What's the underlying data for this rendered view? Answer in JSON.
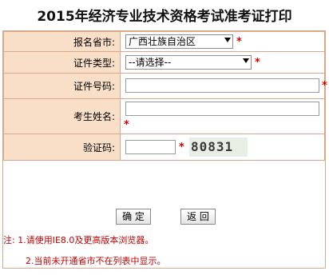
{
  "title": "2015年经济专业技术资格考试准考证打印",
  "form": {
    "province": {
      "label": "报名省市:",
      "value": "广西壮族自治区",
      "required": "*"
    },
    "id_type": {
      "label": "证件类型:",
      "value": "--请选择--",
      "required": "*"
    },
    "id_number": {
      "label": "证件号码:",
      "value": "",
      "required": "*"
    },
    "name": {
      "label": "考生姓名:",
      "value": "",
      "required": "*"
    },
    "captcha": {
      "label": "验证码:",
      "value": "",
      "required": "*",
      "image_text": "80831"
    }
  },
  "buttons": {
    "confirm": "确 定",
    "back": "返 回"
  },
  "notes": {
    "line1": "注: 1.请使用IE8.0及更高版本浏览器。",
    "line2": "2.当前未开通省市不在列表中显示。"
  }
}
